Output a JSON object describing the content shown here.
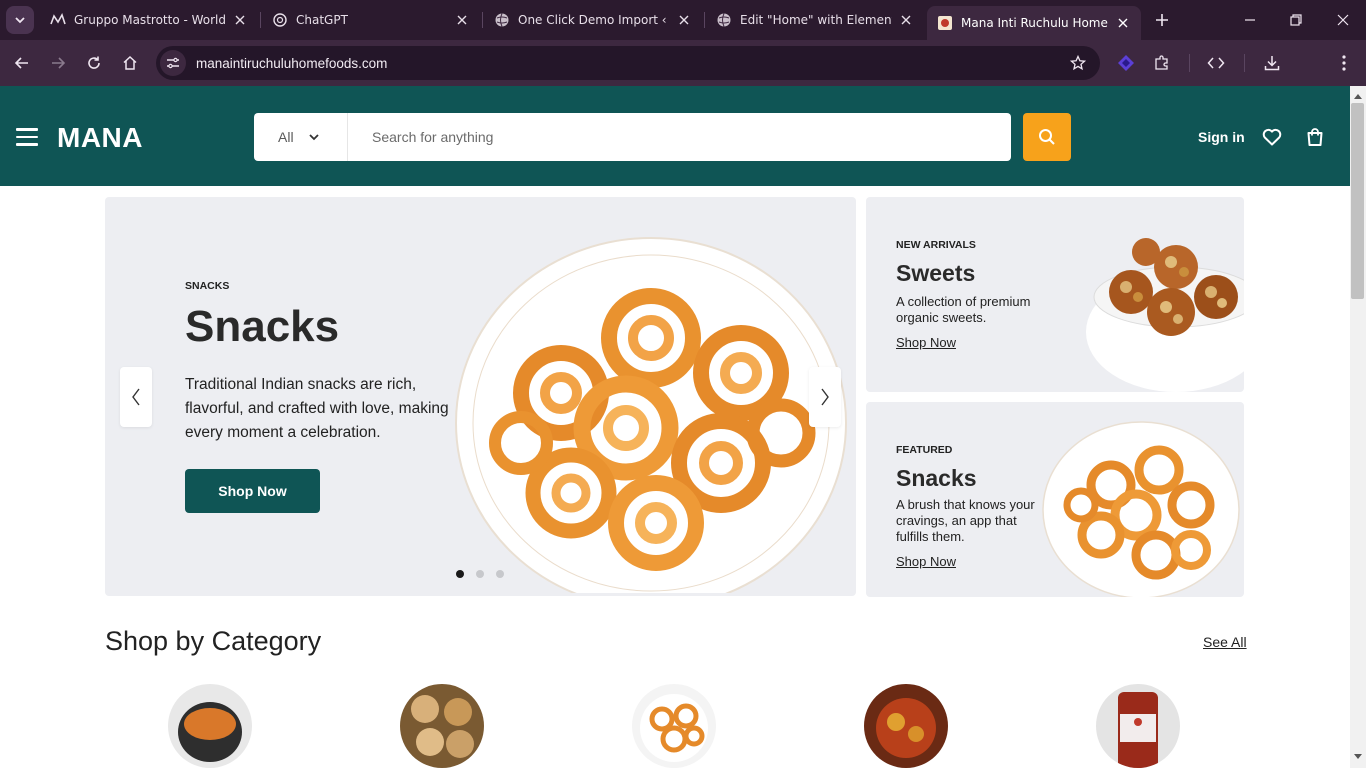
{
  "browser": {
    "tabs": [
      {
        "title": "Gruppo Mastrotto - World le",
        "active": false
      },
      {
        "title": "ChatGPT",
        "active": false
      },
      {
        "title": "One Click Demo Import ‹ Ru",
        "active": false
      },
      {
        "title": "Edit \"Home\" with Elementor",
        "active": false
      },
      {
        "title": "Mana Inti Ruchulu Home Foo",
        "active": true
      }
    ],
    "url": "manaintiruchuluhomefoods.com"
  },
  "header": {
    "logo": "MANA",
    "category_select": "All",
    "search_placeholder": "Search for anything",
    "signin": "Sign in"
  },
  "hero": {
    "eyebrow": "SNACKS",
    "title": "Snacks",
    "description": "Traditional Indian snacks are rich, flavorful, and crafted with love, making every moment a celebration.",
    "button": "Shop Now",
    "slides_total": 3,
    "active_slide": 1
  },
  "promos": [
    {
      "eyebrow": "NEW ARRIVALS",
      "title": "Sweets",
      "description": "A collection of premium organic sweets.",
      "link": "Shop Now"
    },
    {
      "eyebrow": "FEATURED",
      "title": "Snacks",
      "description": "A brush that knows your cravings, an app that fulfills them.",
      "link": "Shop Now"
    }
  ],
  "categories": {
    "heading": "Shop by Category",
    "see_all": "See All"
  },
  "colors": {
    "brand": "#0f5555",
    "accent": "#f7a21b",
    "chrome_dark": "#2b1a2e",
    "chrome_toolbar": "#3d2840"
  }
}
